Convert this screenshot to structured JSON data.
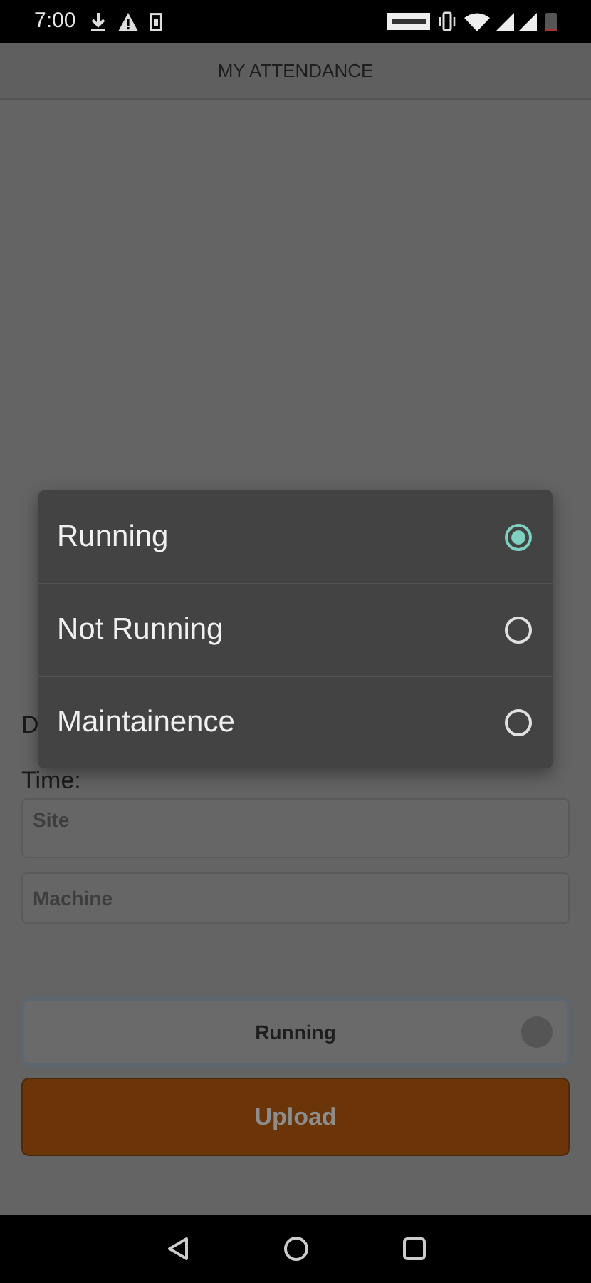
{
  "status_bar": {
    "time": "7:00"
  },
  "header": {
    "title": "MY ATTENDANCE"
  },
  "form": {
    "date_label": "D",
    "time_label": "Time:",
    "site": {
      "placeholder": "Site"
    },
    "machine": {
      "placeholder": "Machine"
    },
    "status_select": {
      "value": "Running"
    },
    "upload_button": "Upload"
  },
  "dialog": {
    "options": [
      {
        "label": "Running",
        "selected": true
      },
      {
        "label": "Not Running",
        "selected": false
      },
      {
        "label": "Maintainence",
        "selected": false
      }
    ]
  }
}
